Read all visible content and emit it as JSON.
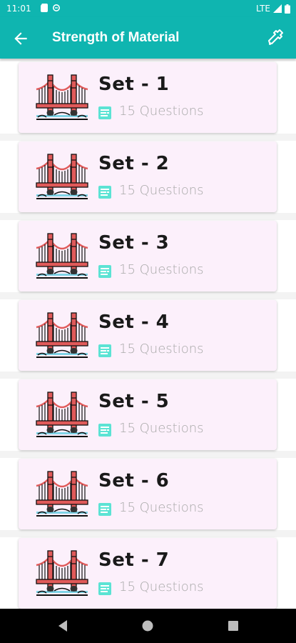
{
  "status_bar": {
    "time": "11:01",
    "network": "LTE"
  },
  "app_bar": {
    "title": "Strength of Material"
  },
  "accent": "#0fb5b0",
  "card_bg": "#fcf0fb",
  "sets": [
    {
      "title": "Set - 1",
      "questions": "15 Questions"
    },
    {
      "title": "Set - 2",
      "questions": "15 Questions"
    },
    {
      "title": "Set - 3",
      "questions": "15 Questions"
    },
    {
      "title": "Set - 4",
      "questions": "15 Questions"
    },
    {
      "title": "Set - 5",
      "questions": "15 Questions"
    },
    {
      "title": "Set - 6",
      "questions": "15 Questions"
    },
    {
      "title": "Set - 7",
      "questions": "15 Questions"
    }
  ],
  "icons": {
    "back": "arrow-left-icon",
    "toolbar_right": "wrench-icon",
    "set_image": "bridge-icon",
    "questions": "question-list-icon"
  }
}
